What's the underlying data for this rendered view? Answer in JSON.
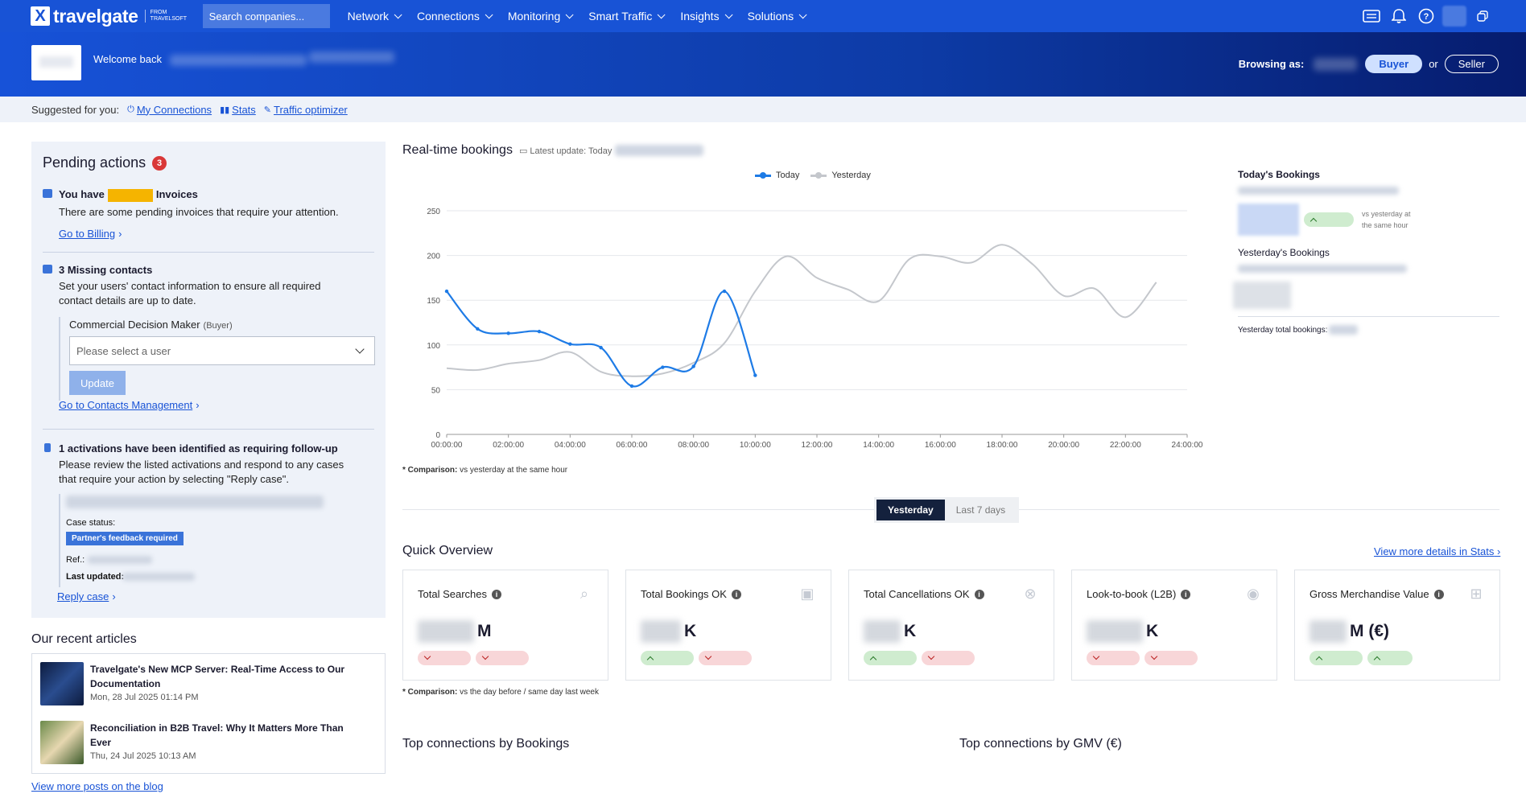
{
  "nav": {
    "brand": "travelgate",
    "brand_sub": "FROM TRAVELSOFT",
    "search_placeholder": "Search companies...",
    "menu": [
      "Network",
      "Connections",
      "Monitoring",
      "Smart Traffic",
      "Insights",
      "Solutions"
    ],
    "icons": [
      "ticket-icon",
      "bell-icon",
      "help-icon",
      "avatar",
      "copy-icon"
    ]
  },
  "banner": {
    "welcome": "Welcome back",
    "browsing_label": "Browsing as:",
    "buyer": "Buyer",
    "or": "or",
    "seller": "Seller"
  },
  "suggest": {
    "label": "Suggested for you:",
    "links": [
      "My Connections",
      "Stats",
      "Traffic optimizer"
    ]
  },
  "pending": {
    "title": "Pending actions",
    "count": "3",
    "invoices_pre": "You have",
    "invoices_post": "Invoices",
    "invoices_desc": "There are some pending invoices that require your attention.",
    "billing_link": "Go to Billing",
    "contacts_title": "3 Missing contacts",
    "contacts_desc": "Set your users' contact information to ensure all required contact details are up to date.",
    "role_label": "Commercial Decision Maker",
    "role_hint": "(Buyer)",
    "select_placeholder": "Please select a user",
    "update": "Update",
    "contacts_link": "Go to Contacts Management",
    "activations_title": "1 activations have been identified as requiring follow-up",
    "activations_desc": "Please review the listed activations and respond to any cases that require your action by selecting \"Reply case\".",
    "case_status_label": "Case status:",
    "case_status": "Partner's feedback required",
    "ref_label": "Ref.:",
    "updated_label": "Last updated:",
    "reply_link": "Reply case"
  },
  "articles": {
    "title": "Our recent articles",
    "items": [
      {
        "title": "Travelgate's New MCP Server: Real-Time Access to Our Documentation",
        "date": "Mon, 28 Jul 2025 01:14 PM"
      },
      {
        "title": "Reconciliation in B2B Travel: Why It Matters More Than Ever",
        "date": "Thu, 24 Jul 2025 10:13 AM"
      }
    ],
    "blog_link": "View more posts on the blog"
  },
  "realtime": {
    "title": "Real-time bookings",
    "latest_update": "Latest update: Today",
    "comparison_label": "* Comparison:",
    "comparison_text": "vs yesterday at the same hour"
  },
  "side": {
    "today_title": "Today's Bookings",
    "vs_text": "vs yesterday at the same hour",
    "yesterday_title": "Yesterday's Bookings",
    "total_label": "Yesterday total bookings:"
  },
  "toggle": {
    "active": "Yesterday",
    "inactive": "Last 7 days"
  },
  "overview": {
    "title": "Quick Overview",
    "link": "View more details in Stats",
    "comparison_label": "* Comparison:",
    "comparison_text": "vs the day before / same day last week",
    "cards": [
      {
        "label": "Total Searches",
        "suffix": "M",
        "icon": "search-icon",
        "chips": [
          "red",
          "red"
        ]
      },
      {
        "label": "Total Bookings OK",
        "suffix": "K",
        "icon": "money-icon",
        "chips": [
          "green",
          "red"
        ]
      },
      {
        "label": "Total Cancellations OK",
        "suffix": "K",
        "icon": "cancel-icon",
        "chips": [
          "green",
          "red"
        ]
      },
      {
        "label": "Look-to-book (L2B)",
        "suffix": "K",
        "icon": "eye-icon",
        "chips": [
          "red",
          "red"
        ]
      },
      {
        "label": "Gross Merchandise Value",
        "suffix": "M (€)",
        "icon": "gift-icon",
        "chips": [
          "green",
          "green"
        ]
      }
    ]
  },
  "top_connections": {
    "bookings": "Top connections by Bookings",
    "gmv": "Top connections by GMV (€)"
  },
  "colors": {
    "brand": "#1853d6",
    "today": "#1e7be6",
    "yesterday": "#c4c7cc"
  },
  "chart_data": {
    "type": "line",
    "title": "",
    "xlabel": "",
    "ylabel": "",
    "x_ticks": [
      "00:00:00",
      "02:00:00",
      "04:00:00",
      "06:00:00",
      "08:00:00",
      "10:00:00",
      "12:00:00",
      "14:00:00",
      "16:00:00",
      "18:00:00",
      "20:00:00",
      "22:00:00",
      "24:00:00"
    ],
    "y_ticks": [
      0,
      50,
      100,
      150,
      200,
      250
    ],
    "ylim": [
      0,
      250
    ],
    "xlim": [
      0,
      24
    ],
    "grid": true,
    "legend": "top-center",
    "series": [
      {
        "name": "Today",
        "x": [
          0,
          1,
          2,
          3,
          4,
          5,
          6,
          7,
          8,
          9,
          10
        ],
        "y": [
          160,
          118,
          113,
          115,
          101,
          97,
          54,
          75,
          76,
          160,
          66
        ]
      },
      {
        "name": "Yesterday",
        "x": [
          0,
          1,
          2,
          3,
          4,
          5,
          6,
          7,
          8,
          9,
          10,
          11,
          12,
          13,
          14,
          15,
          16,
          17,
          18,
          19,
          20,
          21,
          22,
          23
        ],
        "y": [
          74,
          72,
          79,
          83,
          92,
          70,
          65,
          68,
          80,
          102,
          160,
          199,
          175,
          162,
          149,
          196,
          199,
          192,
          212,
          190,
          155,
          163,
          131,
          170
        ]
      }
    ]
  }
}
